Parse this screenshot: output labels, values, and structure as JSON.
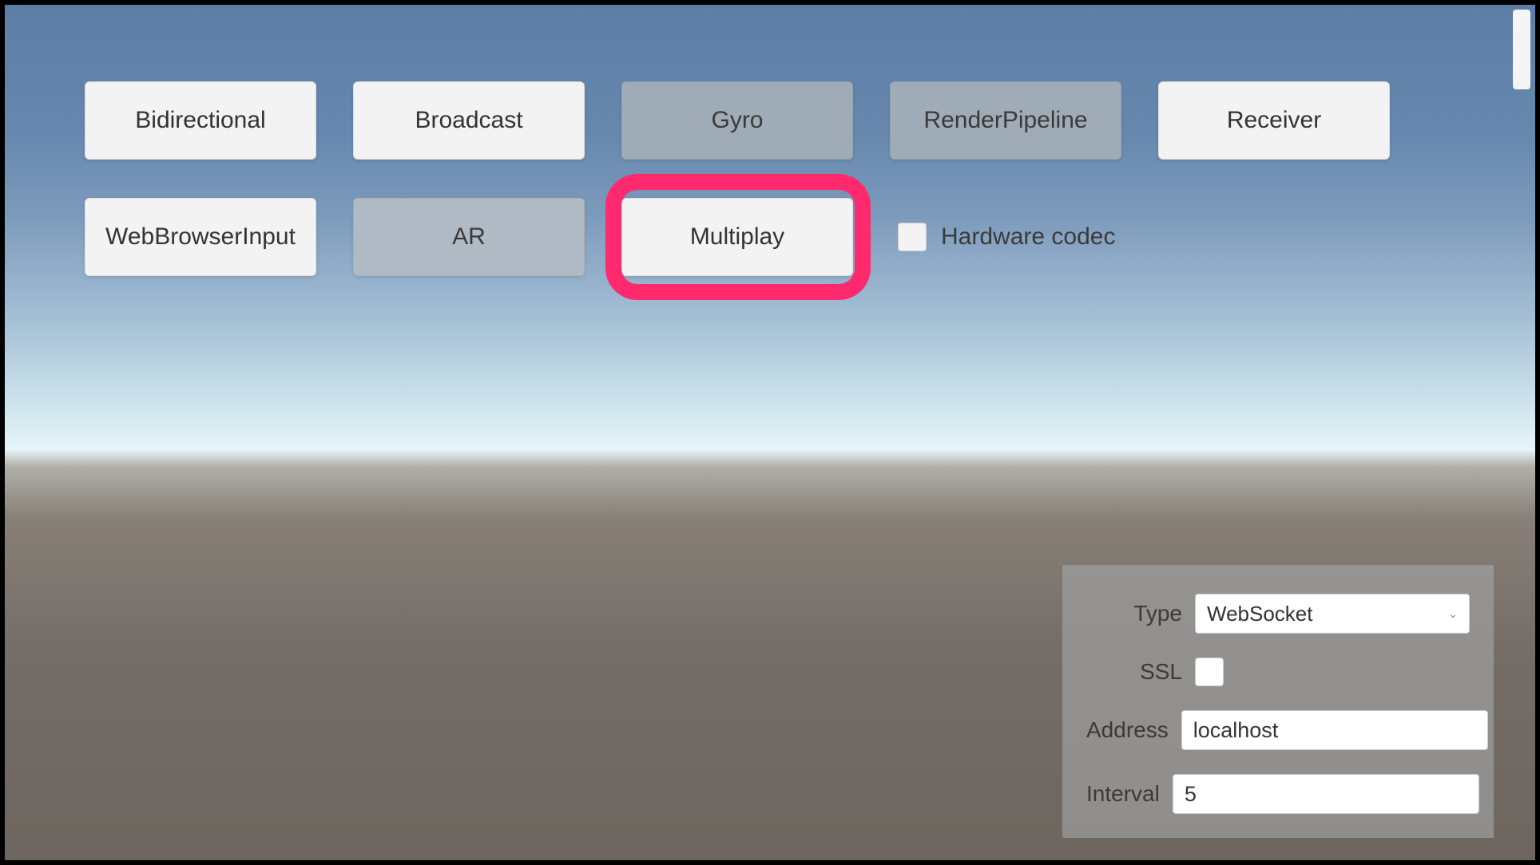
{
  "buttons": {
    "row1": [
      {
        "label": "Bidirectional",
        "state": "enabled"
      },
      {
        "label": "Broadcast",
        "state": "enabled"
      },
      {
        "label": "Gyro",
        "state": "disabled"
      },
      {
        "label": "RenderPipeline",
        "state": "disabled"
      },
      {
        "label": "Receiver",
        "state": "enabled"
      }
    ],
    "row2": [
      {
        "label": "WebBrowserInput",
        "state": "enabled"
      },
      {
        "label": "AR",
        "state": "disabled-light"
      },
      {
        "label": "Multiplay",
        "state": "enabled",
        "highlighted": true
      }
    ]
  },
  "hardwareCodec": {
    "label": "Hardware codec",
    "checked": false
  },
  "settings": {
    "type": {
      "label": "Type",
      "value": "WebSocket"
    },
    "ssl": {
      "label": "SSL",
      "checked": false
    },
    "address": {
      "label": "Address",
      "value": "localhost"
    },
    "interval": {
      "label": "Interval",
      "value": "5"
    }
  }
}
